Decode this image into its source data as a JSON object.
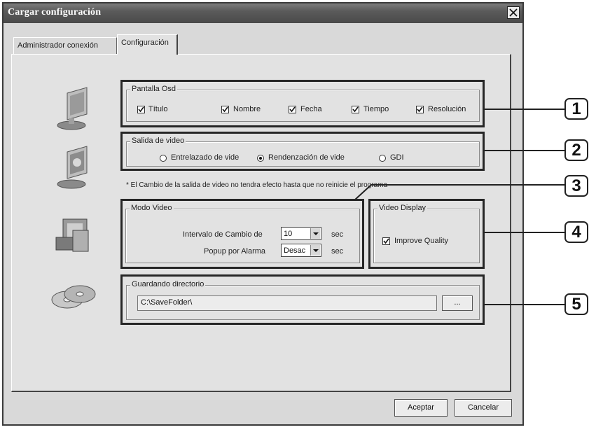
{
  "window": {
    "title": "Cargar configuración"
  },
  "tabs": [
    {
      "label": "Administrador conexión"
    },
    {
      "label": "Configuración"
    }
  ],
  "osd": {
    "legend": "Pantalla Osd",
    "items": [
      {
        "label": "Título",
        "checked": true
      },
      {
        "label": "Nombre",
        "checked": true
      },
      {
        "label": "Fecha",
        "checked": true
      },
      {
        "label": "Tiempo",
        "checked": true
      },
      {
        "label": "Resolución",
        "checked": true
      }
    ]
  },
  "video_out": {
    "legend": "Salida de video",
    "options": [
      {
        "label": "Entrelazado de vide",
        "selected": false
      },
      {
        "label": "Rendenzación de vide",
        "selected": true
      },
      {
        "label": "GDI",
        "selected": false
      }
    ],
    "note": "* El Cambio de la salida de video no tendra efecto hasta que no reinicie el programa"
  },
  "video_mode": {
    "legend": "Modo Video",
    "interval_label": "Intervalo de Cambio de",
    "interval_value": "10",
    "interval_unit": "sec",
    "popup_label": "Popup por Alarma",
    "popup_value": "Desac",
    "popup_unit": "sec"
  },
  "video_display": {
    "legend": "Video Display",
    "improve_label": "Improve Quality",
    "improve_checked": true
  },
  "save_dir": {
    "legend": "Guardando directorio",
    "path": "C:\\SaveFolder\\",
    "browse_label": "..."
  },
  "buttons": {
    "ok": "Aceptar",
    "cancel": "Cancelar"
  },
  "callouts": [
    "1",
    "2",
    "3",
    "4",
    "5"
  ]
}
